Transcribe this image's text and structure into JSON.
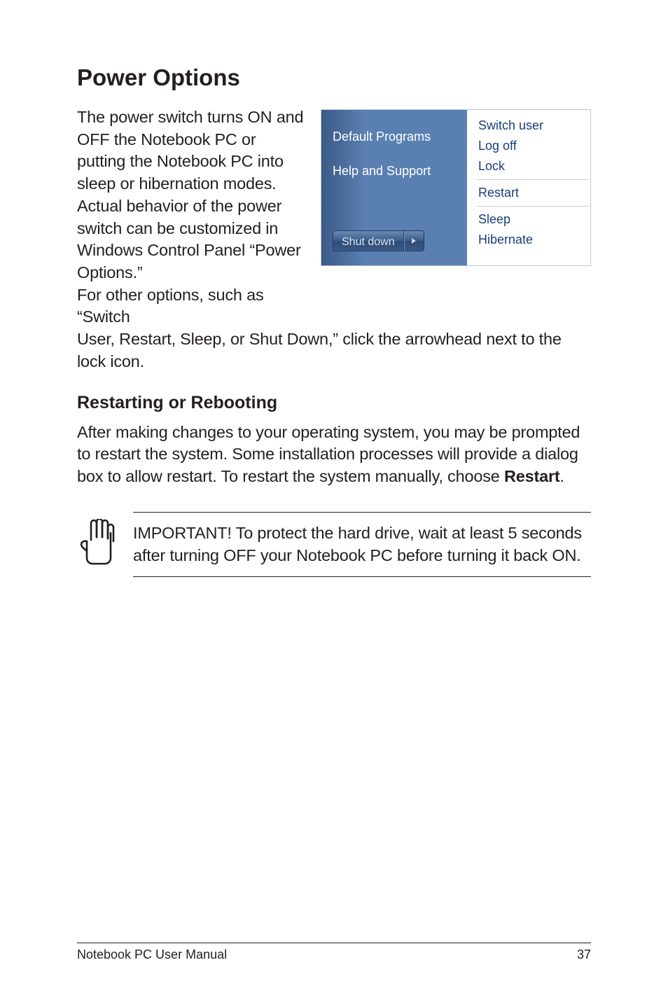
{
  "title": "Power Options",
  "intro_part1": "The power switch turns ON and OFF the Notebook PC or putting the Notebook PC into sleep or hibernation modes. Actual behavior of the power switch can be customized in Windows Control Panel “Power Options.”",
  "intro_part2": "For other options, such as “Switch",
  "after_figure": "User, Restart, Sleep, or Shut Down,” click the arrowhead next to the lock icon.",
  "figure": {
    "left": {
      "default_programs": "Default Programs",
      "help_support": "Help and Support",
      "shutdown": "Shut down"
    },
    "right": {
      "switch_user": "Switch user",
      "log_off": "Log off",
      "lock": "Lock",
      "restart": "Restart",
      "sleep": "Sleep",
      "hibernate": "Hibernate"
    }
  },
  "subhead": "Restarting or Rebooting",
  "body_para_pre": "After making changes to your operating system, you may be prompted to restart the system. Some installation processes will provide a dialog box to allow restart. To restart the system manually, choose ",
  "body_para_bold": "Restart",
  "body_para_post": ".",
  "note": "IMPORTANT!  To protect the hard drive, wait at least 5 seconds after turning OFF your Notebook PC before turning it back ON.",
  "footer_left": "Notebook PC User Manual",
  "footer_right": "37"
}
